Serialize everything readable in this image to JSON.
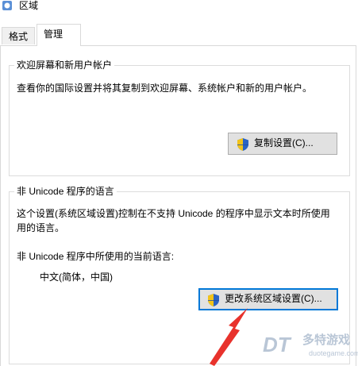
{
  "window": {
    "title": "区域"
  },
  "tabs": [
    {
      "label": "格式",
      "selected": false
    },
    {
      "label": "管理",
      "selected": true
    }
  ],
  "welcome_group": {
    "title": "欢迎屏幕和新用户帐户",
    "description": "查看你的国际设置并将其复制到欢迎屏幕、系统帐户和新的用户帐户。",
    "copy_button_label": "复制设置(C)..."
  },
  "unicode_group": {
    "title": "非 Unicode 程序的语言",
    "description_line1": "这个设置(系统区域设置)控制在不支持 Unicode 的程序中显示文本时所使用",
    "description_line2": "用的语言。",
    "current_label": "非 Unicode 程序中所使用的当前语言:",
    "current_value": "中文(简体，中国)",
    "change_button_label": "更改系统区域设置(C)..."
  },
  "watermark": {
    "logo_text": "DT",
    "cn_text": "多特游戏",
    "en_text": "duotegame.com"
  },
  "colors": {
    "arrow": "#e8322c",
    "button_focus": "#0078d7",
    "shield_blue": "#2a63c4",
    "shield_yellow": "#f2c319"
  },
  "icons": {
    "title": "region-globe-icon",
    "button": "uac-shield-icon"
  }
}
